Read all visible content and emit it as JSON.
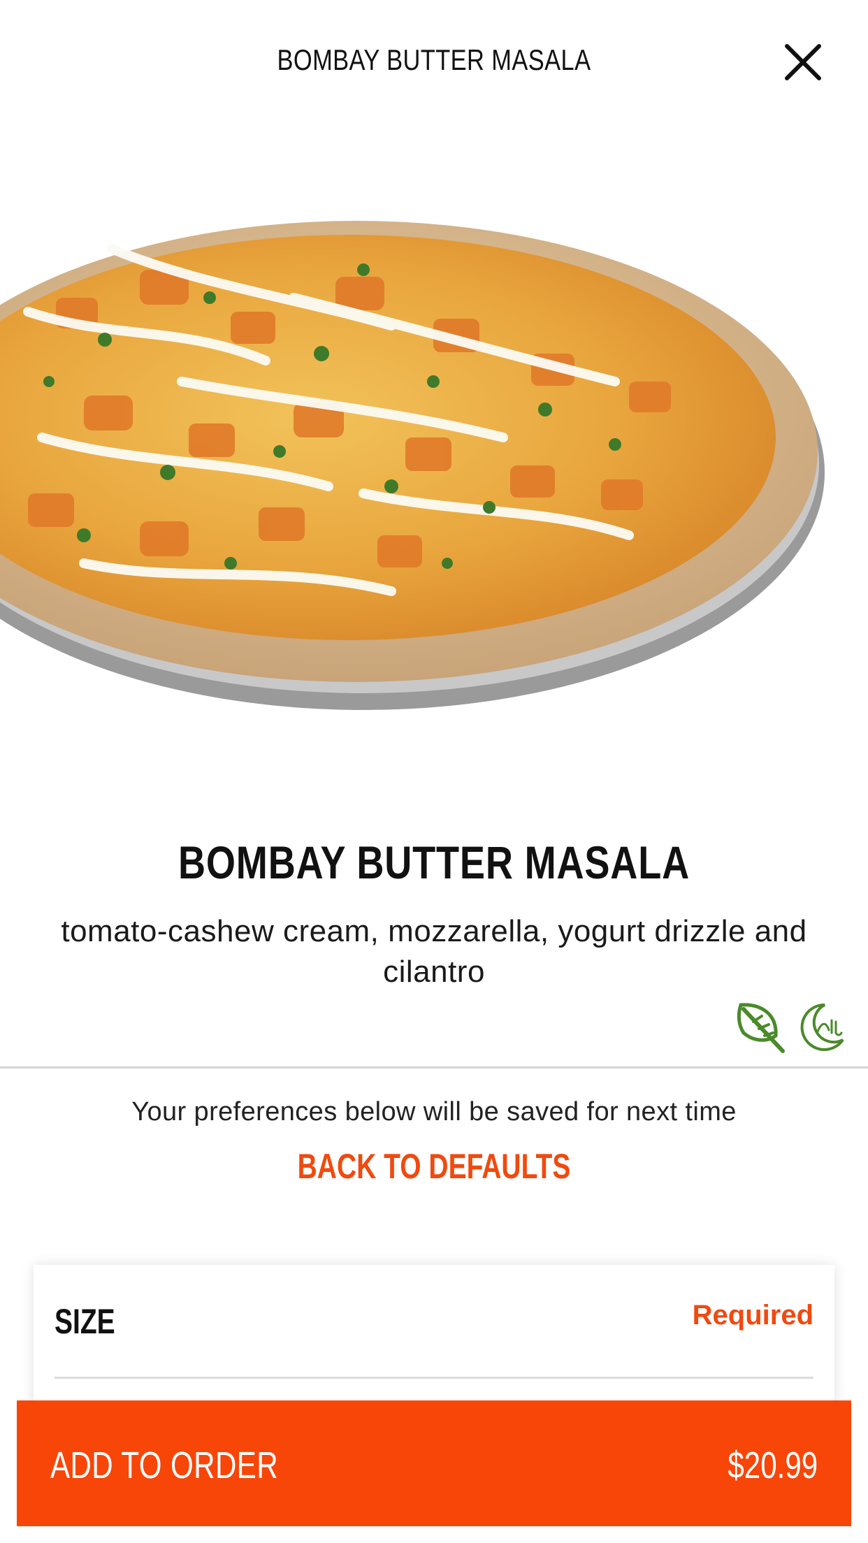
{
  "header": {
    "title": "BOMBAY BUTTER MASALA",
    "close_icon": "close-icon"
  },
  "hero": {
    "image_subject": "pizza"
  },
  "product": {
    "name": "BOMBAY BUTTER MASALA",
    "description": "tomato-cashew cream, mozzarella, yogurt drizzle and cilantro",
    "badges": [
      "leaf-icon",
      "halal-icon"
    ],
    "badge_color": "#4a8a2a"
  },
  "preferences": {
    "note": "Your preferences below will be saved for next time",
    "back_to_defaults": "BACK TO DEFAULTS"
  },
  "size_section": {
    "title": "SIZE",
    "status": "Required"
  },
  "order_button": {
    "label": "ADD TO ORDER",
    "price": "$20.99"
  },
  "colors": {
    "accent": "#f04a0f",
    "button": "#f74608"
  }
}
